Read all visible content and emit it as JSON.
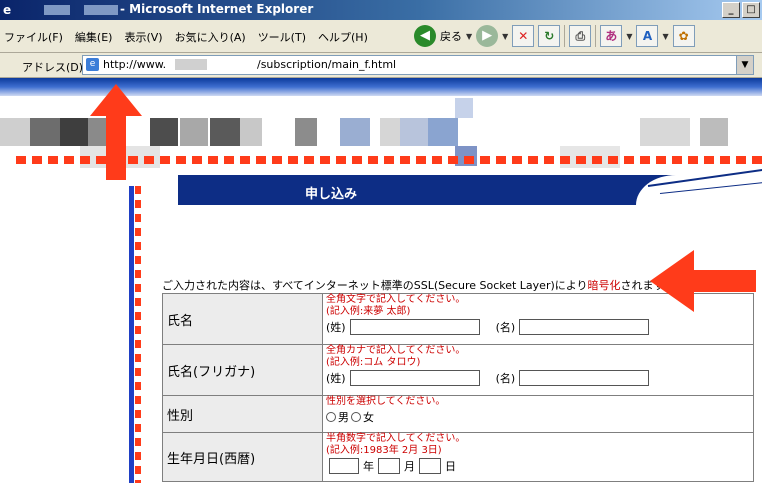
{
  "window": {
    "title": "- Microsoft Internet Explorer",
    "buttons": [
      "_",
      "□"
    ]
  },
  "menu": {
    "items": [
      "ファイル(F)",
      "編集(E)",
      "表示(V)",
      "お気に入り(A)",
      "ツール(T)",
      "ヘルプ(H)"
    ]
  },
  "toolbar": {
    "back_label": "戻る"
  },
  "address": {
    "label": "アドレス(D)",
    "url_prefix": "http://www.",
    "url_suffix": "/subscription/main_f.html"
  },
  "form": {
    "banner_title": "申し込み",
    "ssl_notice_pre": "ご入力された内容は、すべてインターネット標準のSSL(Secure Socket Layer)により",
    "ssl_notice_highlight": "暗号化",
    "ssl_notice_post": "されます。",
    "rows": [
      {
        "label": "氏名",
        "instruction_1": "全角文字で記入してください。",
        "instruction_2": "(記入例:来夢 太郎)",
        "field_1_label": "(姓)",
        "field_2_label": "(名)"
      },
      {
        "label": "氏名(フリガナ)",
        "instruction_1": "全角カナで記入してください。",
        "instruction_2": "(記入例:コム タロウ)",
        "field_1_label": "(姓)",
        "field_2_label": "(名)"
      },
      {
        "label": "性別",
        "instruction_1": "性別を選択してください。",
        "option_male": "男",
        "option_female": "女"
      },
      {
        "label": "生年月日(西暦)",
        "instruction_1": "半角数字で記入してください。",
        "instruction_2": "(記入例:1983年 2月 3日)",
        "year_label": "年",
        "month_label": "月",
        "day_label": "日"
      }
    ]
  },
  "colors": {
    "annotation": "#ff3b1a",
    "banner": "#0d2d85",
    "instruction": "#cc0000"
  }
}
